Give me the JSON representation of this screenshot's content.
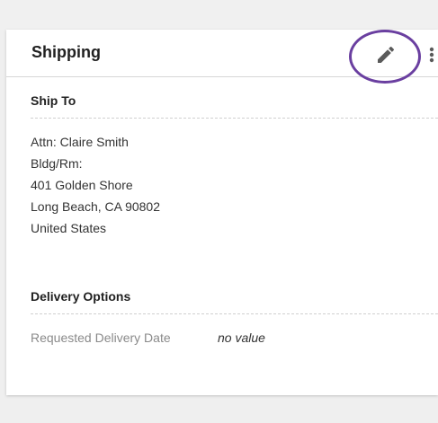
{
  "card": {
    "title": "Shipping",
    "edit_icon": "pencil-icon",
    "more_icon": "more-vertical-icon",
    "highlight_color": "#6a3fa0"
  },
  "ship_to": {
    "title": "Ship To",
    "lines": [
      "Attn: Claire Smith",
      "Bldg/Rm:",
      "401 Golden Shore",
      "Long Beach, CA 90802",
      "United States"
    ]
  },
  "delivery_options": {
    "title": "Delivery Options",
    "fields": [
      {
        "label": "Requested Delivery Date",
        "value": "no value"
      }
    ]
  }
}
